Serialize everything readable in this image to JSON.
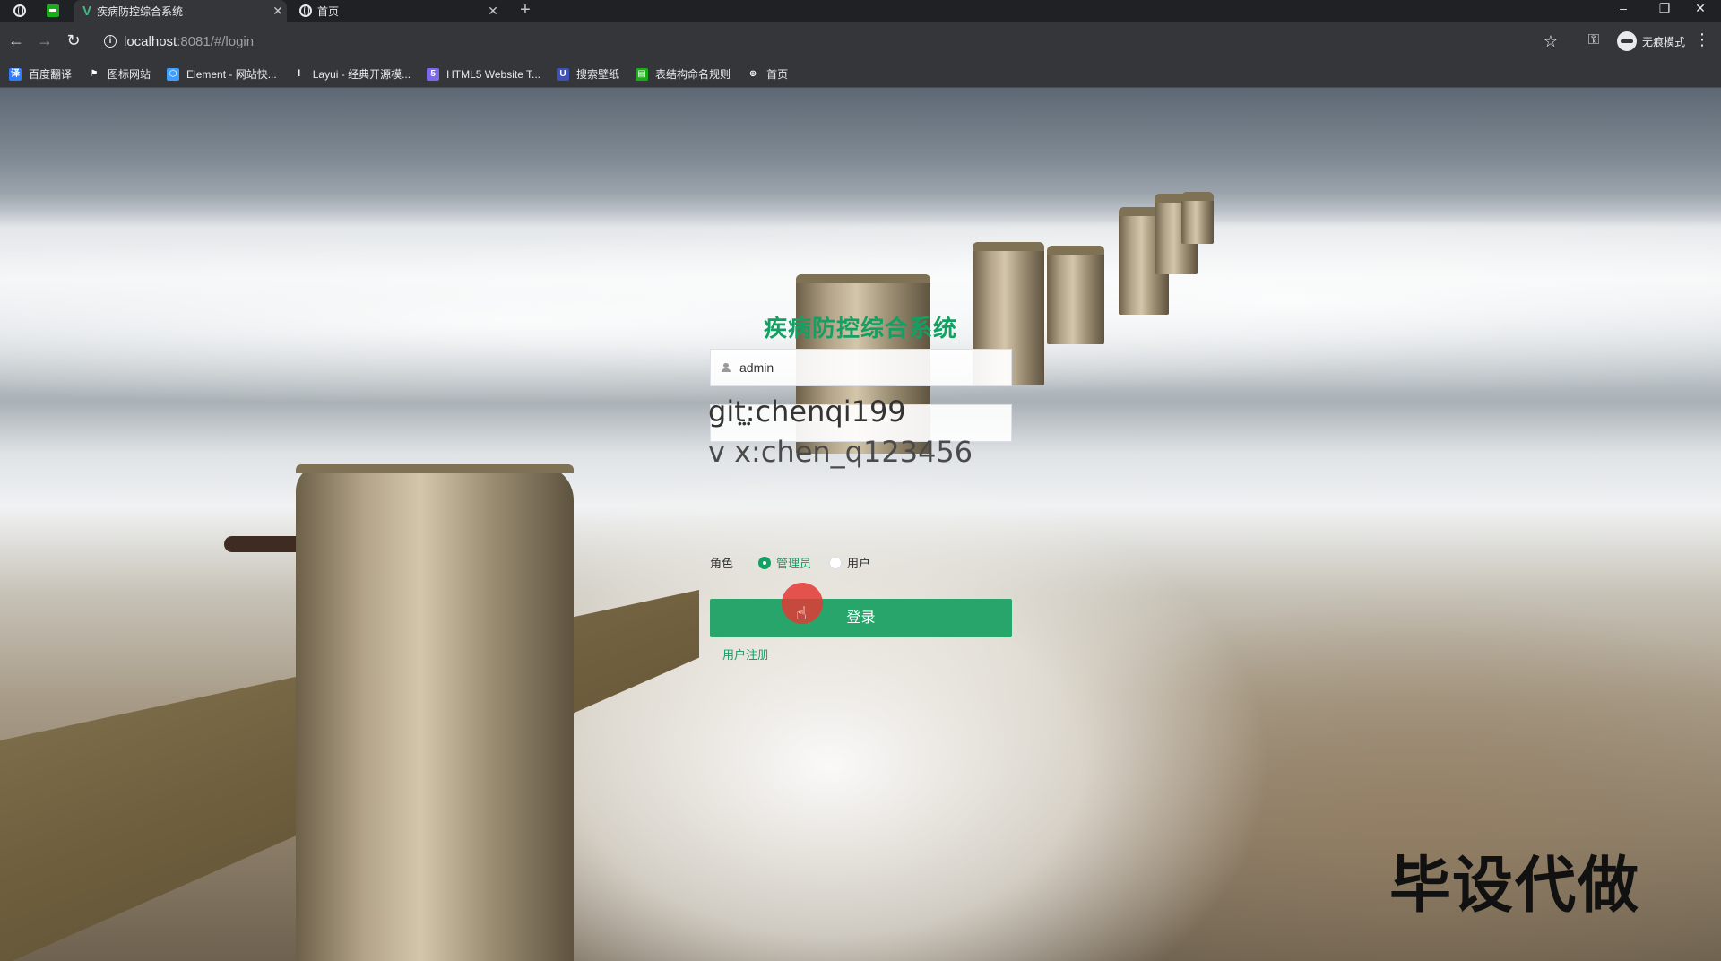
{
  "browser": {
    "tabs": [
      {
        "title": "疾病防控综合系统",
        "active": true
      },
      {
        "title": "首页",
        "active": false
      }
    ],
    "new_tab_label": "+",
    "address": {
      "host": "localhost",
      "rest": ":8081/#/login"
    },
    "incognito_label": "无痕模式",
    "window_controls": {
      "minimize": "–",
      "restore": "❐",
      "close": "✕"
    },
    "bookmarks": [
      {
        "label": "百度翻译",
        "icon": "baidu-translate-icon",
        "color": "#2f7cff",
        "glyph": "译"
      },
      {
        "label": "图标网站",
        "icon": "flag-icon",
        "color": "#35363a",
        "glyph": "⚑"
      },
      {
        "label": "Element - 网站快...",
        "icon": "element-icon",
        "color": "#409eff",
        "glyph": "⬡"
      },
      {
        "label": "Layui - 经典开源模...",
        "icon": "layui-icon",
        "color": "#35363a",
        "glyph": "l"
      },
      {
        "label": "HTML5 Website T...",
        "icon": "html5-icon",
        "color": "#7b68ee",
        "glyph": "5"
      },
      {
        "label": "搜索壁纸",
        "icon": "wallpaper-icon",
        "color": "#3f51b5",
        "glyph": "U"
      },
      {
        "label": "表结构命名规则",
        "icon": "doc-icon",
        "color": "#1aad19",
        "glyph": "▤"
      },
      {
        "label": "首页",
        "icon": "globe-icon",
        "color": "#35363a",
        "glyph": "⊕"
      }
    ]
  },
  "login": {
    "title": "疾病防控综合系统",
    "username_value": "admin",
    "password_mask": "•••",
    "role_label": "角色",
    "roles": [
      {
        "label": "管理员",
        "checked": true
      },
      {
        "label": "用户",
        "checked": false
      }
    ],
    "submit_label": "登录",
    "register_label": "用户注册"
  },
  "overlay": {
    "line1": "git:chenqi199",
    "line2": "v x:chen_q123456",
    "watermark": "毕设代做"
  },
  "colors": {
    "accent": "#13a063",
    "button": "#27a56a",
    "click_marker": "#e23834"
  }
}
